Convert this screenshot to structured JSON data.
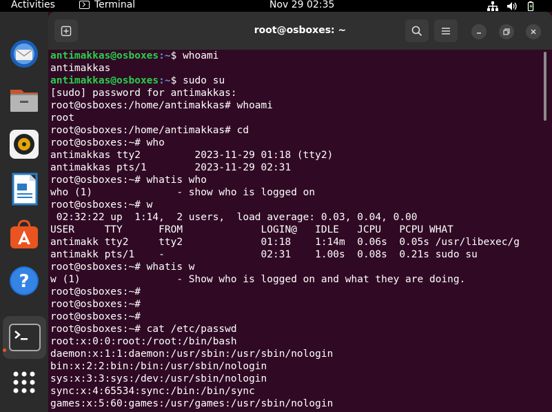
{
  "topbar": {
    "activities": "Activities",
    "app_name": "Terminal",
    "clock": "Nov 29  02:35",
    "tray_icons": [
      "network-icon",
      "volume-icon",
      "battery-icon"
    ]
  },
  "dock": {
    "items": [
      "thunderbird-icon",
      "files-icon",
      "rhythmbox-icon",
      "writer-icon",
      "software-icon",
      "help-icon",
      "terminal-icon",
      "app-grid-icon"
    ]
  },
  "window": {
    "title": "root@osboxes: ~"
  },
  "terminal": {
    "lines": [
      {
        "user": "antimakkas@osboxes",
        "path": ":~",
        "rest": "$ whoami"
      },
      {
        "text": "antimakkas"
      },
      {
        "user": "antimakkas@osboxes",
        "path": ":~",
        "rest": "$ sudo su"
      },
      {
        "text": "[sudo] password for antimakkas:"
      },
      {
        "text": "root@osboxes:/home/antimakkas# whoami"
      },
      {
        "text": "root"
      },
      {
        "text": "root@osboxes:/home/antimakkas# cd"
      },
      {
        "text": "root@osboxes:~# who"
      },
      {
        "text": "antimakkas tty2         2023-11-29 01:18 (tty2)"
      },
      {
        "text": "antimakkas pts/1        2023-11-29 02:31"
      },
      {
        "text": "root@osboxes:~# whatis who"
      },
      {
        "text": "who (1)              - show who is logged on"
      },
      {
        "text": "root@osboxes:~# w"
      },
      {
        "text": " 02:32:22 up  1:14,  2 users,  load average: 0.03, 0.04, 0.00"
      },
      {
        "text": "USER     TTY      FROM             LOGIN@   IDLE   JCPU   PCPU WHAT"
      },
      {
        "text": "antimakk tty2     tty2             01:18    1:14m  0.06s  0.05s /usr/libexec/g"
      },
      {
        "text": "antimakk pts/1    -                02:31    1.00s  0.08s  0.21s sudo su"
      },
      {
        "text": "root@osboxes:~# whatis w"
      },
      {
        "text": "w (1)                - Show who is logged on and what they are doing."
      },
      {
        "text": "root@osboxes:~#"
      },
      {
        "text": "root@osboxes:~#"
      },
      {
        "text": "root@osboxes:~#"
      },
      {
        "text": "root@osboxes:~# cat /etc/passwd"
      },
      {
        "text": "root:x:0:0:root:/root:/bin/bash"
      },
      {
        "text": "daemon:x:1:1:daemon:/usr/sbin:/usr/sbin/nologin"
      },
      {
        "text": "bin:x:2:2:bin:/bin:/usr/sbin/nologin"
      },
      {
        "text": "sys:x:3:3:sys:/dev:/usr/sbin/nologin"
      },
      {
        "text": "sync:x:4:65534:sync:/bin:/bin/sync"
      },
      {
        "text": "games:x:5:60:games:/usr/games:/usr/sbin/nologin"
      }
    ]
  },
  "colors": {
    "terminal_bg": "#300a24",
    "user_green": "#26d04a",
    "path_blue": "#6b8fd6",
    "accent_orange": "#e95420"
  }
}
